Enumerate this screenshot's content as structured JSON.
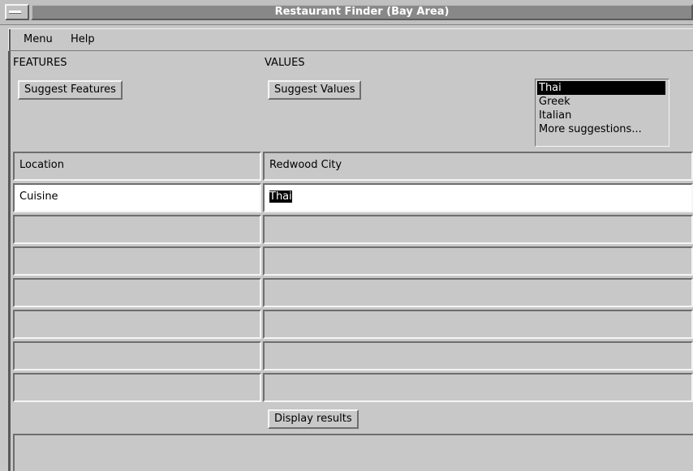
{
  "window": {
    "title": "Restaurant Finder (Bay Area)"
  },
  "menubar": {
    "items": [
      "Menu",
      "Help"
    ]
  },
  "features": {
    "header": "FEATURES",
    "suggest_button": "Suggest Features"
  },
  "values": {
    "header": "VALUES",
    "suggest_button": "Suggest Values"
  },
  "suggestions": {
    "options": [
      "Thai",
      "Greek",
      "Italian",
      "More suggestions..."
    ],
    "selected_index": 0
  },
  "rows": [
    {
      "feature": "Location",
      "value": "Redwood City"
    },
    {
      "feature": "Cuisine",
      "value": "Thai"
    },
    {
      "feature": "",
      "value": ""
    },
    {
      "feature": "",
      "value": ""
    },
    {
      "feature": "",
      "value": ""
    },
    {
      "feature": "",
      "value": ""
    },
    {
      "feature": "",
      "value": ""
    },
    {
      "feature": "",
      "value": ""
    }
  ],
  "actions": {
    "display_results": "Display results"
  },
  "status": {
    "text": ""
  }
}
